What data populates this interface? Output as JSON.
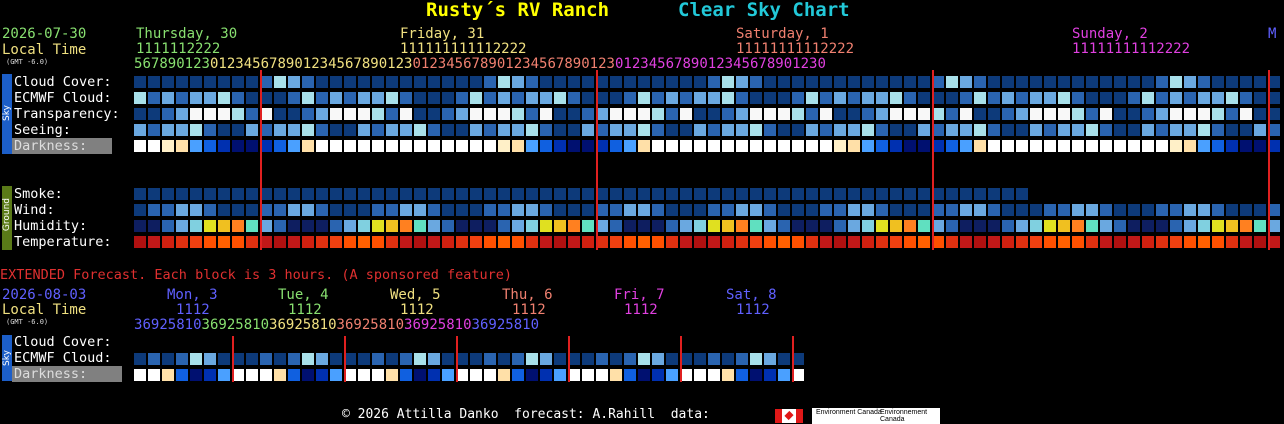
{
  "header": {
    "site": "Rusty´s RV Ranch",
    "chart_name": "Clear Sky Chart",
    "site_color": "#ffff00",
    "chart_color": "#22c8d8"
  },
  "main": {
    "date": "2026-07-30",
    "local_time": "Local Time",
    "gmt": "(GMT -6.0)",
    "days": [
      {
        "label": "Thursday, 30",
        "color": "#88e070",
        "tens": "11111112222",
        "units": "567890123"
      },
      {
        "label": "Friday, 31",
        "color": "#f0e080",
        "tens": "11111111112222",
        "units": "01234567890123"
      },
      {
        "label": "Saturday, 1",
        "color": "#f08070",
        "tens": "11111111112222",
        "units": "01234567890123"
      },
      {
        "label": "Sunday, 2",
        "color": "#e040e0",
        "tens": "11111111112222",
        "units": "01234567890123"
      },
      {
        "label": "M",
        "color": "#6060ff"
      }
    ],
    "hours_row": "5678901230123456789012345678901230123456789012345678901230123456789012345678901230",
    "tens_row_thu": "1111112222",
    "tens_row_fri": "111111111112222",
    "tens_row_sat": "11111111112222",
    "tens_row_sun": "11111111112222",
    "sky_tag": "Sky",
    "ground_tag": "Ground",
    "rows_sky": [
      "Cloud Cover:",
      "ECMWF Cloud:",
      "Transparency:",
      "Seeing:",
      "Darkness:"
    ],
    "rows_ground": [
      "Smoke:",
      "Wind:",
      "Humidity:",
      "Temperature:"
    ]
  },
  "extended": {
    "notice": "EXTENDED Forecast. Each block is 3 hours. (A sponsored feature)",
    "date": "2026-08-03",
    "local_time": "Local Time",
    "gmt": "(GMT -6.0)",
    "days": [
      {
        "label": "Mon, 3",
        "color": "#6060ff"
      },
      {
        "label": "Tue, 4",
        "color": "#88e070"
      },
      {
        "label": "Wed, 5",
        "color": "#f0e080"
      },
      {
        "label": "Thu, 6",
        "color": "#f08070"
      },
      {
        "label": "Fri, 7",
        "color": "#e040e0"
      },
      {
        "label": "Sat, 8",
        "color": "#6060ff"
      }
    ],
    "tens": "1112",
    "hours": "369258103692581036925810369258103692581036925810",
    "rows": [
      "Cloud Cover:",
      "ECMWF Cloud:",
      "Darkness:"
    ]
  },
  "footer": {
    "text": "© 2026 Attilla Danko  forecast: A.Rahill  data:",
    "agency1": "Environment Canada",
    "agency2": "Environnement Canada"
  },
  "colors": {
    "clear": "#0d3a7a",
    "cloud_mid": "#2a64b0",
    "cloud_light": "#6aa8e0",
    "cloud_pale": "#a8e0ea",
    "overcast": "#f8f8f8",
    "midnight_line": "#e02020"
  }
}
